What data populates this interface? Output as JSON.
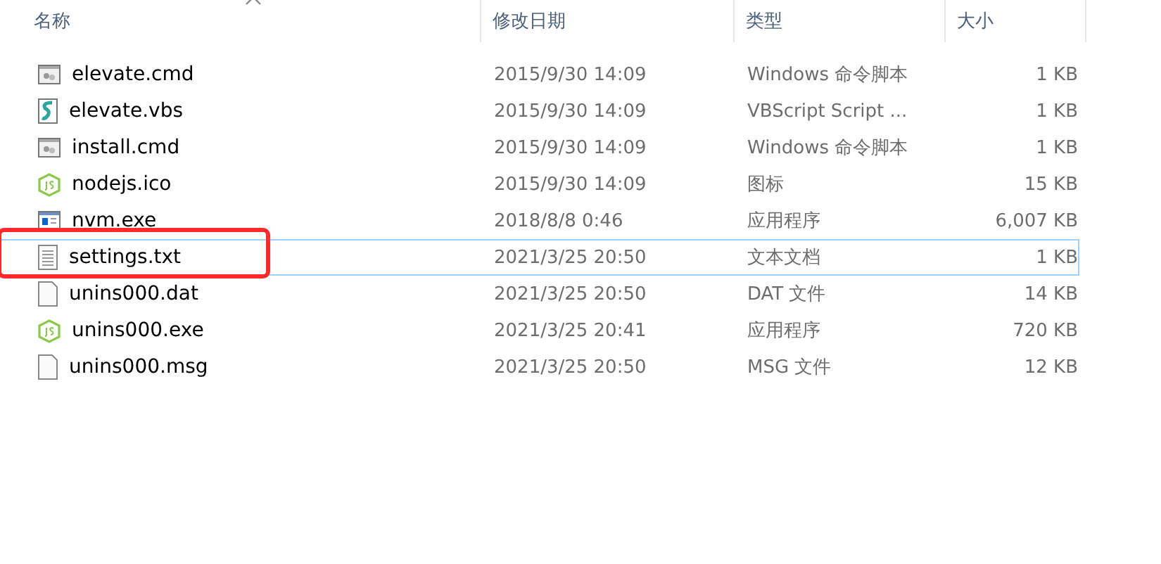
{
  "columns": [
    {
      "label": "名称",
      "sorted": true
    },
    {
      "label": "修改日期",
      "sorted": false
    },
    {
      "label": "类型",
      "sorted": false
    },
    {
      "label": "大小",
      "sorted": false
    }
  ],
  "rows": [
    {
      "kind": "cmd",
      "name": "elevate.cmd",
      "date": "2015/9/30 14:09",
      "type": "Windows 命令脚本",
      "size": "1 KB",
      "focused": false,
      "annotated": false
    },
    {
      "kind": "script",
      "name": "elevate.vbs",
      "date": "2015/9/30 14:09",
      "type": "VBScript Script ...",
      "size": "1 KB",
      "focused": false,
      "annotated": false
    },
    {
      "kind": "cmd",
      "name": "install.cmd",
      "date": "2015/9/30 14:09",
      "type": "Windows 命令脚本",
      "size": "1 KB",
      "focused": false,
      "annotated": false
    },
    {
      "kind": "node",
      "name": "nodejs.ico",
      "date": "2015/9/30 14:09",
      "type": "图标",
      "size": "15 KB",
      "focused": false,
      "annotated": false
    },
    {
      "kind": "app",
      "name": "nvm.exe",
      "date": "2018/8/8 0:46",
      "type": "应用程序",
      "size": "6,007 KB",
      "focused": false,
      "annotated": false
    },
    {
      "kind": "text",
      "name": "settings.txt",
      "date": "2021/3/25 20:50",
      "type": "文本文档",
      "size": "1 KB",
      "focused": true,
      "annotated": true
    },
    {
      "kind": "blank",
      "name": "unins000.dat",
      "date": "2021/3/25 20:50",
      "type": "DAT 文件",
      "size": "14 KB",
      "focused": false,
      "annotated": false
    },
    {
      "kind": "node",
      "name": "unins000.exe",
      "date": "2021/3/25 20:41",
      "type": "应用程序",
      "size": "720 KB",
      "focused": false,
      "annotated": false
    },
    {
      "kind": "blank",
      "name": "unins000.msg",
      "date": "2021/3/25 20:50",
      "type": "MSG 文件",
      "size": "12 KB",
      "focused": false,
      "annotated": false
    }
  ]
}
